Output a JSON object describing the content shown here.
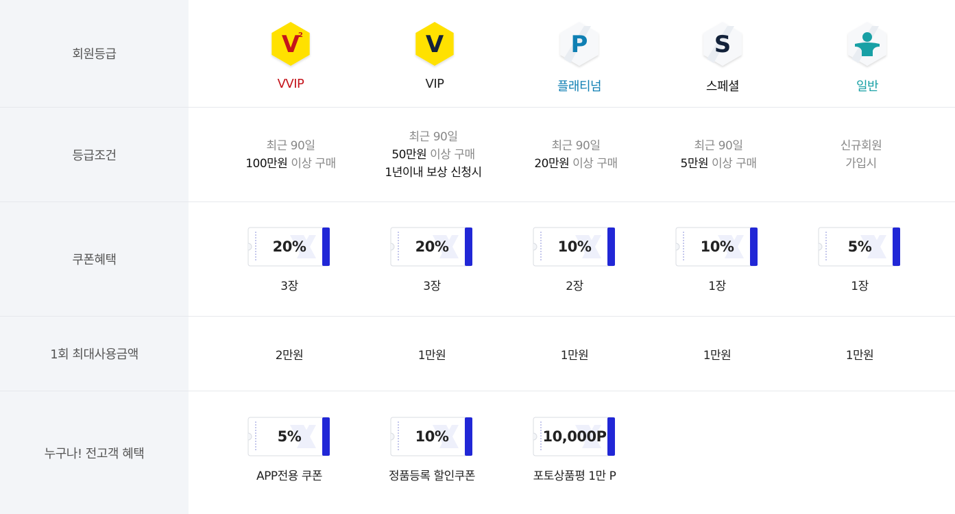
{
  "row_labels": {
    "grade": "회원등급",
    "condition": "등급조건",
    "coupon": "쿠폰혜택",
    "max_amount": "1회 최대사용금액",
    "everyone": "누구나! 전고객 혜택"
  },
  "grades": [
    {
      "badge_letter": "V",
      "badge_super": "2",
      "name": "VVIP",
      "name_color": "#c4141b",
      "badge_color": "#ffe100"
    },
    {
      "badge_letter": "V",
      "badge_super": "",
      "name": "VIP",
      "name_color": "#222222",
      "badge_color": "#ffe100"
    },
    {
      "badge_letter": "P",
      "badge_super": "",
      "name": "플래티넘",
      "name_color": "#0f7fb3",
      "badge_color": "#f7f8fa"
    },
    {
      "badge_letter": "S",
      "badge_super": "",
      "name": "스페셜",
      "name_color": "#111111",
      "badge_color": "#f7f8fa"
    },
    {
      "badge_letter": "",
      "badge_super": "",
      "name": "일반",
      "name_color": "#18a0a5",
      "badge_color": "#f7f8fa"
    }
  ],
  "conditions": [
    {
      "line1": "최근 90일",
      "line2_bold": "100만원",
      "line2_rest": " 이상 구매",
      "line3": ""
    },
    {
      "line1": "최근 90일",
      "line2_bold": "50만원",
      "line2_rest": " 이상 구매",
      "line3": "1년이내 보상 신청시"
    },
    {
      "line1": "최근 90일",
      "line2_bold": "20만원",
      "line2_rest": " 이상 구매",
      "line3": ""
    },
    {
      "line1": "최근 90일",
      "line2_bold": "5만원",
      "line2_rest": " 이상 구매",
      "line3": ""
    },
    {
      "line1": "신규회원",
      "line2_bold": "",
      "line2_rest": "가입시",
      "line3": ""
    }
  ],
  "coupons": [
    {
      "value": "20%",
      "count": "3장"
    },
    {
      "value": "20%",
      "count": "3장"
    },
    {
      "value": "10%",
      "count": "2장"
    },
    {
      "value": "10%",
      "count": "1장"
    },
    {
      "value": "5%",
      "count": "1장"
    }
  ],
  "max_amounts": [
    "2만원",
    "1만원",
    "1만원",
    "1만원",
    "1만원"
  ],
  "everyone_benefits": [
    {
      "value": "5%",
      "label": "APP전용 쿠폰"
    },
    {
      "value": "10%",
      "label": "정품등록 할인쿠폰"
    },
    {
      "value": "10,000P",
      "label": "포토상품평 1만 P"
    }
  ],
  "colors": {
    "coupon_accent": "#2127d6",
    "side_bg": "#f3f5f8",
    "divider": "#e6e8ec"
  }
}
